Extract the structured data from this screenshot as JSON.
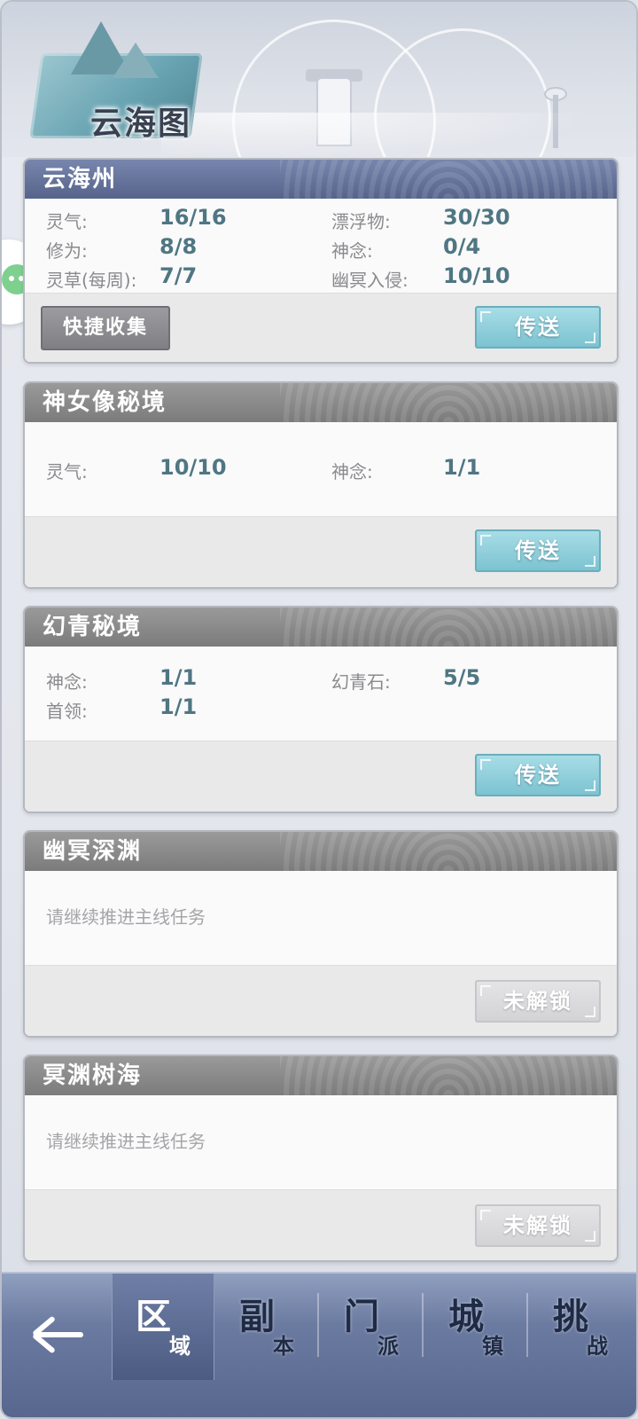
{
  "header": {
    "title": "云海图"
  },
  "cards": [
    {
      "title": "云海州",
      "stats": [
        {
          "label": "灵气:",
          "value": "16/16"
        },
        {
          "label": "漂浮物:",
          "value": "30/30"
        },
        {
          "label": "修为:",
          "value": "8/8"
        },
        {
          "label": "神念:",
          "value": "0/4"
        },
        {
          "label": "灵草(每周):",
          "value": "7/7"
        },
        {
          "label": "幽冥入侵:",
          "value": "10/10"
        }
      ],
      "collect_label": "快捷收集",
      "action_label": "传送"
    },
    {
      "title": "神女像秘境",
      "stats": [
        {
          "label": "灵气:",
          "value": "10/10"
        },
        {
          "label": "神念:",
          "value": "1/1"
        }
      ],
      "action_label": "传送"
    },
    {
      "title": "幻青秘境",
      "stats": [
        {
          "label": "神念:",
          "value": "1/1"
        },
        {
          "label": "幻青石:",
          "value": "5/5"
        },
        {
          "label": "首领:",
          "value": "1/1"
        }
      ],
      "action_label": "传送"
    },
    {
      "title": "幽冥深渊",
      "hint": "请继续推进主线任务",
      "action_label": "未解锁"
    },
    {
      "title": "冥渊树海",
      "hint": "请继续推进主线任务",
      "action_label": "未解锁"
    }
  ],
  "bottom_nav": {
    "back_icon": "back-arrow-icon",
    "tabs": [
      {
        "big": "区",
        "small": "域",
        "active": true
      },
      {
        "big": "副",
        "small": "本",
        "active": false
      },
      {
        "big": "门",
        "small": "派",
        "active": false
      },
      {
        "big": "城",
        "small": "镇",
        "active": false
      },
      {
        "big": "挑",
        "small": "战",
        "active": false
      }
    ]
  },
  "colors": {
    "header_blue": "#56648c",
    "header_gray": "#7b7b7b",
    "value_teal": "#4f7683",
    "teleport_button": "#7cc3d1"
  }
}
